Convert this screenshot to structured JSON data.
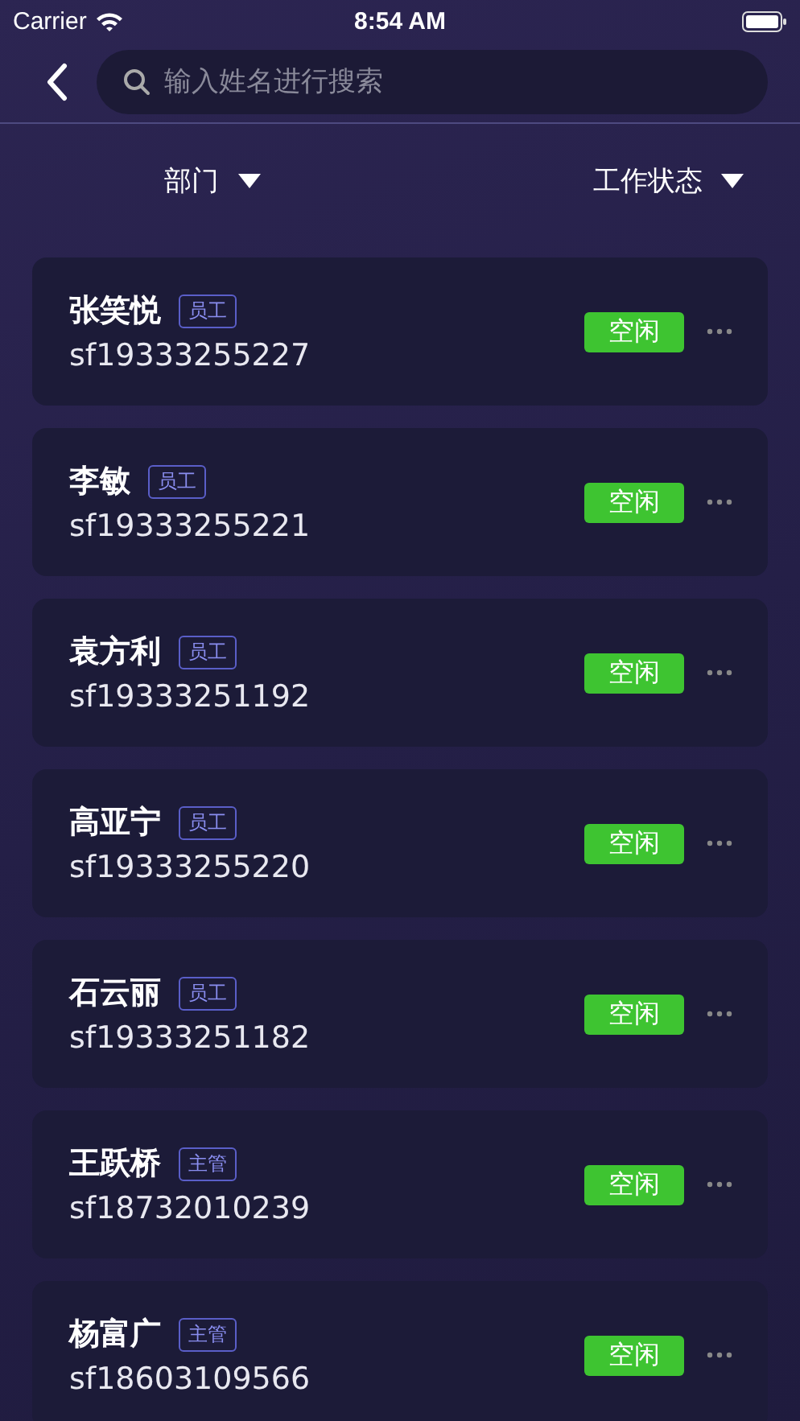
{
  "status_bar": {
    "carrier": "Carrier",
    "time": "8:54 AM"
  },
  "search": {
    "placeholder": "输入姓名进行搜索"
  },
  "filters": [
    {
      "label": "部门"
    },
    {
      "label": "工作状态"
    }
  ],
  "employees": [
    {
      "name": "张笑悦",
      "role": "员工",
      "account": "sf19333255227",
      "status": "空闲"
    },
    {
      "name": "李敏",
      "role": "员工",
      "account": "sf19333255221",
      "status": "空闲"
    },
    {
      "name": "袁方利",
      "role": "员工",
      "account": "sf19333251192",
      "status": "空闲"
    },
    {
      "name": "高亚宁",
      "role": "员工",
      "account": "sf19333255220",
      "status": "空闲"
    },
    {
      "name": "石云丽",
      "role": "员工",
      "account": "sf19333251182",
      "status": "空闲"
    },
    {
      "name": "王跃桥",
      "role": "主管",
      "account": "sf18732010239",
      "status": "空闲"
    },
    {
      "name": "杨富广",
      "role": "主管",
      "account": "sf18603109566",
      "status": "空闲"
    }
  ]
}
